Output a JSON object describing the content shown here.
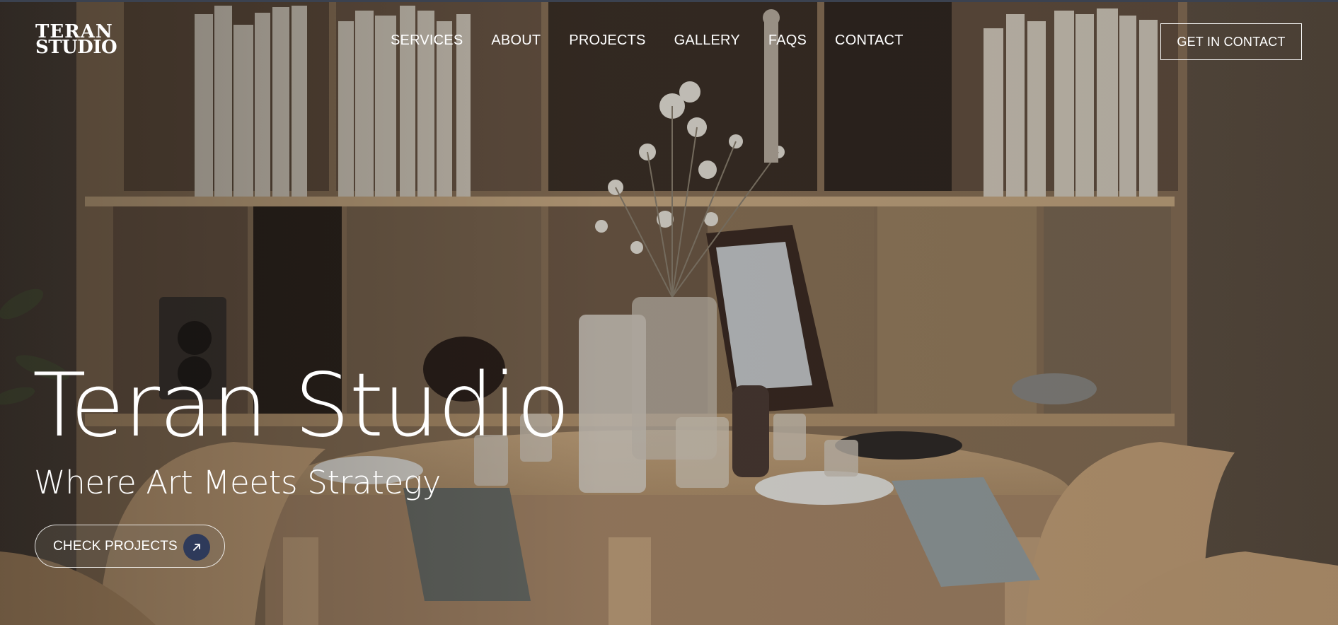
{
  "brand": {
    "logo_line1": "TERAN",
    "logo_line2": "STUDIO"
  },
  "nav": {
    "items": [
      {
        "label": "SERVICES"
      },
      {
        "label": "ABOUT"
      },
      {
        "label": "PROJECTS"
      },
      {
        "label": "GALLERY"
      },
      {
        "label": "FAQS"
      },
      {
        "label": "CONTACT"
      }
    ],
    "cta_label": "GET IN CONTACT"
  },
  "hero": {
    "title": "Teran Studio",
    "subtitle": "Where Art Meets Strategy",
    "cta_label": "CHECK PROJECTS",
    "cta_icon": "arrow-up-right-icon",
    "background_image": "dining-room-interior-photo"
  },
  "colors": {
    "text": "#ffffff",
    "cta_icon_bg": "#2e3a5a",
    "wood": "#b89a74"
  }
}
